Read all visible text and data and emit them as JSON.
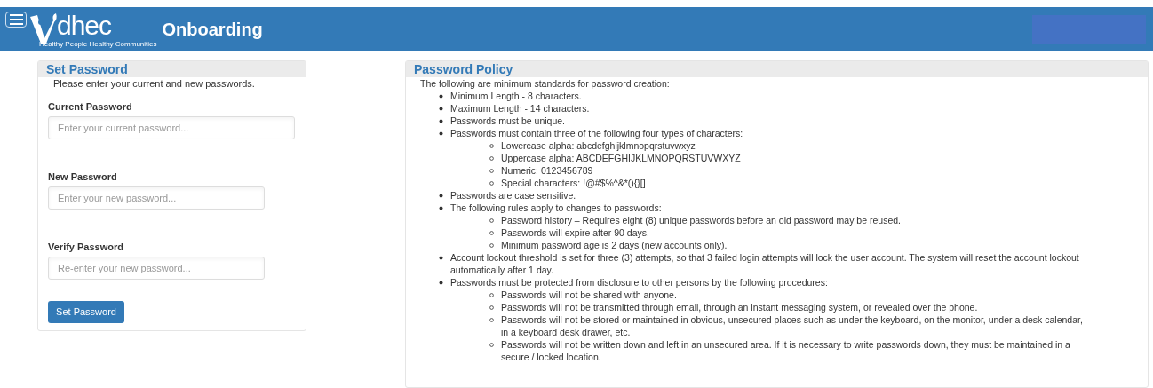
{
  "header": {
    "logo_text": "dhec",
    "tagline": "Healthy People Healthy Communities",
    "title": "Onboarding"
  },
  "set_password": {
    "title": "Set Password",
    "intro": "Please enter your current and new passwords.",
    "fields": [
      {
        "label": "Current Password",
        "placeholder": "Enter your current password...",
        "wide": true
      },
      {
        "label": "New Password",
        "placeholder": "Enter your new password...",
        "wide": false
      },
      {
        "label": "Verify Password",
        "placeholder": "Re-enter your new password...",
        "wide": false
      }
    ],
    "button": "Set Password"
  },
  "policy": {
    "title": "Password Policy",
    "intro": "The following are minimum standards for password creation:",
    "items": [
      {
        "text": "Minimum Length - 8 characters."
      },
      {
        "text": "Maximum Length - 14 characters."
      },
      {
        "text": "Passwords must be unique."
      },
      {
        "text": "Passwords must contain three of the following four types of characters:",
        "children": [
          {
            "text": "Lowercase alpha: abcdefghijklmnopqrstuvwxyz"
          },
          {
            "text": "Uppercase alpha: ABCDEFGHIJKLMNOPQRSTUVWXYZ"
          },
          {
            "text": "Numeric: 0123456789"
          },
          {
            "text": "Special characters: !@#$%^&*(){}[]"
          }
        ]
      },
      {
        "text": "Passwords are case sensitive."
      },
      {
        "text": "The following rules apply to changes to passwords:",
        "children": [
          {
            "text": "Password history – Requires eight (8) unique passwords before an old password may be reused."
          },
          {
            "text": "Passwords will expire after 90 days."
          },
          {
            "text": "Minimum password age is 2 days (new accounts only)."
          }
        ]
      },
      {
        "text": "Account lockout threshold is set for three (3) attempts, so that 3 failed login attempts will lock the user account. The system will reset the account lockout automatically after 1 day."
      },
      {
        "text": "Passwords must be protected from disclosure to other persons by the following procedures:",
        "children": [
          {
            "text": "Passwords will not be shared with anyone."
          },
          {
            "text": "Passwords will not be transmitted through email, through an instant messaging system, or revealed over the phone."
          },
          {
            "text": "Passwords will not be stored or maintained in obvious, unsecured places such as under the keyboard, on the monitor, under a desk calendar, in a keyboard desk drawer, etc."
          },
          {
            "text": "Passwords will not be written down and left in an unsecured area. If it is necessary to write passwords down, they must be maintained in a secure / locked location."
          }
        ]
      }
    ]
  }
}
